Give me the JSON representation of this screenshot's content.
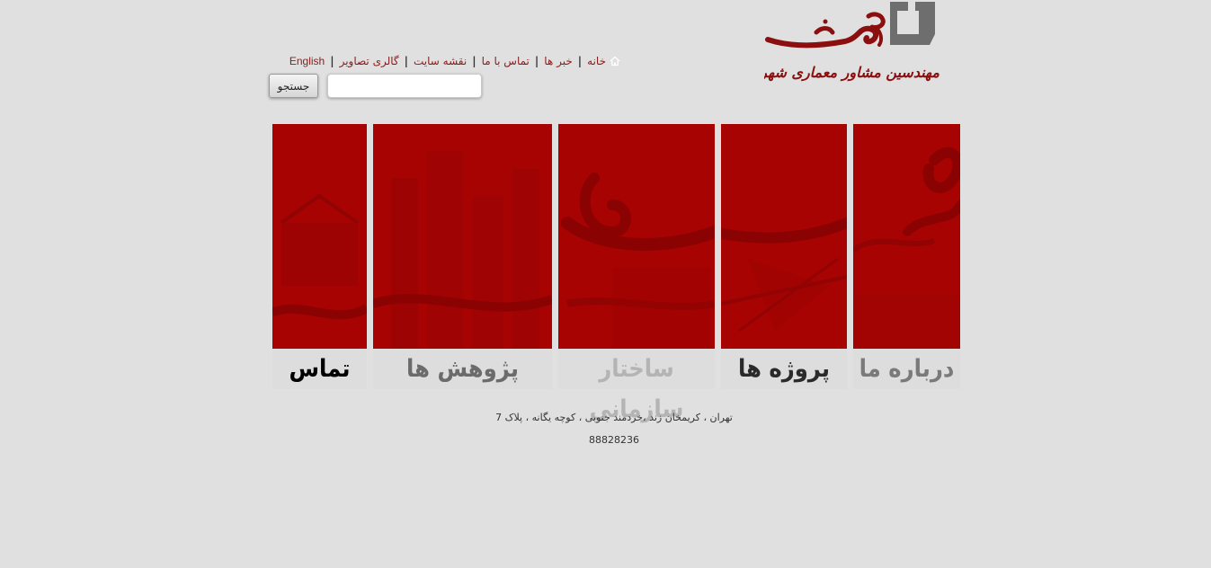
{
  "brand": {
    "logo_wordmark": "عرصه",
    "logo_tagline": "مهندسین مشاور معماری شهرسازی",
    "logo_color": "#8b0f0f",
    "logo_mark_color": "#6e6e6e"
  },
  "topnav": {
    "items": [
      {
        "label": "خانه",
        "icon": "home-icon"
      },
      {
        "label": "خبر ها"
      },
      {
        "label": "تماس با ما"
      },
      {
        "label": "نقشه سایت"
      },
      {
        "label": "گالری تصاویر"
      },
      {
        "label": "English"
      }
    ],
    "separator": "|",
    "link_color": "#8b1a1a"
  },
  "search": {
    "button_label": "جستجو",
    "input_value": "",
    "placeholder": ""
  },
  "panels": [
    {
      "label": "درباره ما",
      "label_color": "#7a7a7a"
    },
    {
      "label": "پروژه ها",
      "label_color": "#2a2a2a"
    },
    {
      "label": "ساختار سازمانی",
      "label_color": "#b4b4b4"
    },
    {
      "label": "پژوهش ها",
      "label_color": "#6b6b6b"
    },
    {
      "label": "تماس",
      "label_color": "#000000"
    }
  ],
  "panel_color": "#a80303",
  "footer": {
    "address": "تهران ، کریمخان زند ،خردمند جنوبی ، کوچه یگانه ، پلاک 7",
    "phone": "88828236"
  }
}
